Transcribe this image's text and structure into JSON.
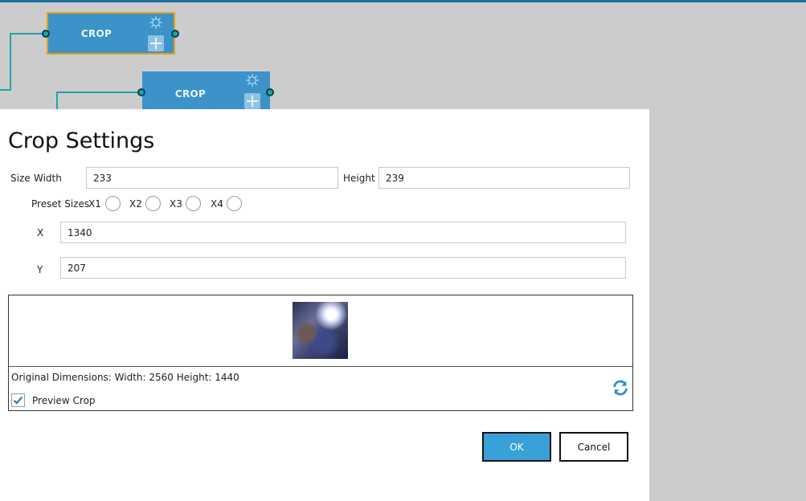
{
  "canvas": {
    "nodes": [
      {
        "label": "CROP"
      },
      {
        "label": "CROP"
      }
    ]
  },
  "dialog": {
    "title": "Crop Settings",
    "size_label": "Size",
    "width_label": "Width",
    "width_value": "233",
    "height_label": "Height",
    "height_value": "239",
    "preset_label": "Preset Sizes",
    "presets": [
      "X1",
      "X2",
      "X3",
      "X4"
    ],
    "x_label": "X",
    "x_value": "1340",
    "y_label": "Y",
    "y_value": "207",
    "original_dimensions": "Original Dimensions: Width: 2560 Height: 1440",
    "preview_crop_label": "Preview Crop",
    "preview_crop_checked": true,
    "ok_label": "OK",
    "cancel_label": "Cancel"
  },
  "colors": {
    "node_fill": "#3d93c9",
    "node_selected_border": "#e0a21a",
    "wire": "#1fa3a6",
    "ok_button": "#3aa0d8",
    "refresh_icon": "#2f8fcf",
    "check_mark": "#1f6fb0"
  },
  "icons": [
    "gear-icon",
    "plus-icon",
    "refresh-icon",
    "checkmark-icon"
  ]
}
